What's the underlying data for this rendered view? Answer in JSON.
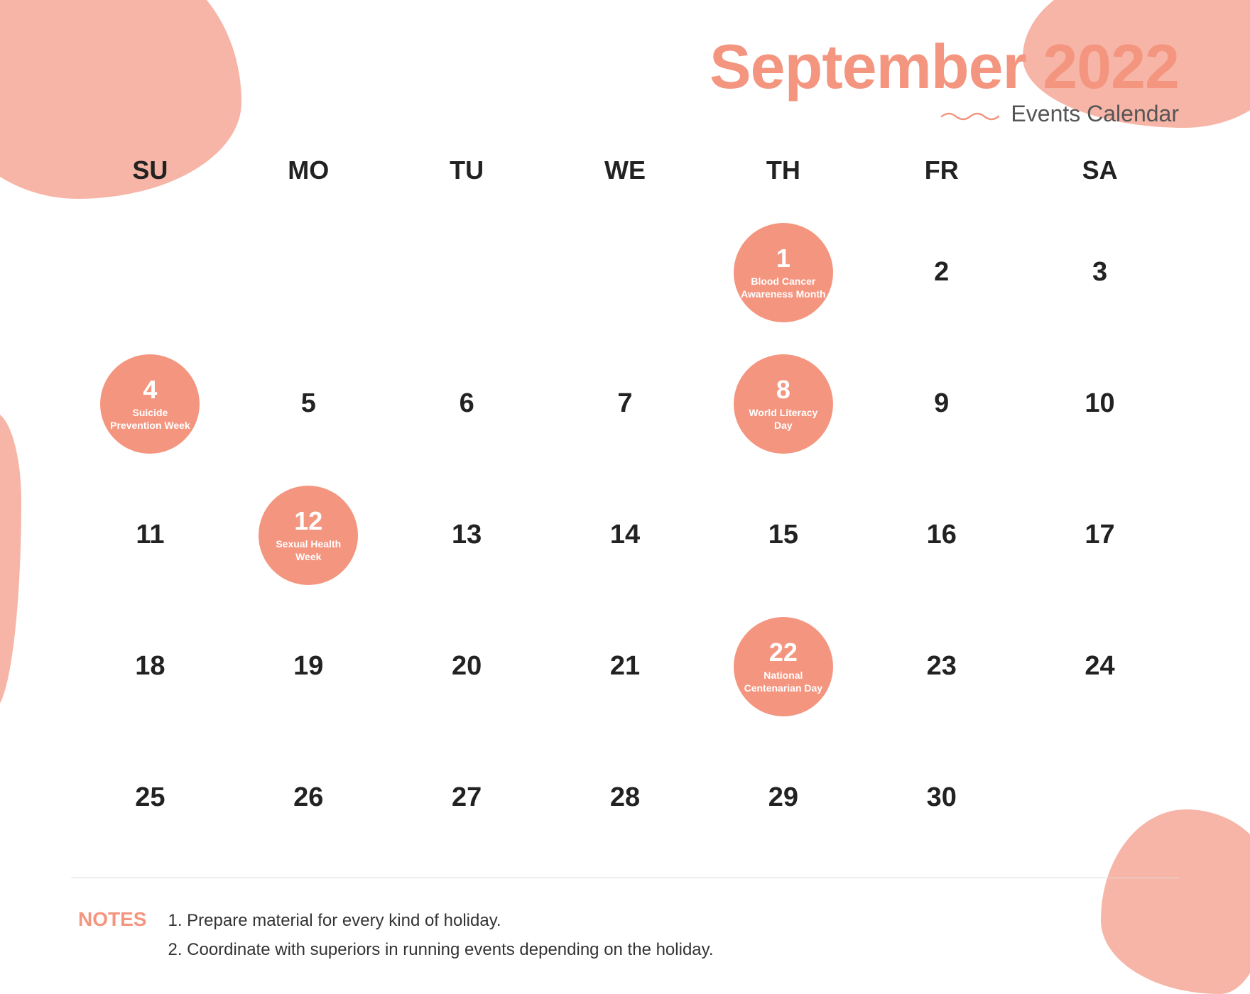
{
  "header": {
    "month": "September",
    "year": "2022",
    "subtitle": "Events Calendar"
  },
  "days": {
    "headers": [
      "SU",
      "MO",
      "TU",
      "WE",
      "TH",
      "FR",
      "SA"
    ]
  },
  "calendar": {
    "rows": [
      [
        {
          "day": "",
          "event": null
        },
        {
          "day": "",
          "event": null
        },
        {
          "day": "",
          "event": null
        },
        {
          "day": "",
          "event": null
        },
        {
          "day": "1",
          "event": {
            "label": "Blood Cancer Awareness Month"
          }
        },
        {
          "day": "2",
          "event": null
        },
        {
          "day": "3",
          "event": null
        }
      ],
      [
        {
          "day": "4",
          "event": {
            "label": "Suicide Prevention Week"
          }
        },
        {
          "day": "5",
          "event": null
        },
        {
          "day": "6",
          "event": null
        },
        {
          "day": "7",
          "event": null
        },
        {
          "day": "8",
          "event": {
            "label": "World Literacy Day"
          }
        },
        {
          "day": "9",
          "event": null
        },
        {
          "day": "10",
          "event": null
        }
      ],
      [
        {
          "day": "11",
          "event": null
        },
        {
          "day": "12",
          "event": {
            "label": "Sexual Health Week"
          }
        },
        {
          "day": "13",
          "event": null
        },
        {
          "day": "14",
          "event": null
        },
        {
          "day": "15",
          "event": null
        },
        {
          "day": "16",
          "event": null
        },
        {
          "day": "17",
          "event": null
        }
      ],
      [
        {
          "day": "18",
          "event": null
        },
        {
          "day": "19",
          "event": null
        },
        {
          "day": "20",
          "event": null
        },
        {
          "day": "21",
          "event": null
        },
        {
          "day": "22",
          "event": {
            "label": "National Centenarian Day"
          }
        },
        {
          "day": "23",
          "event": null
        },
        {
          "day": "24",
          "event": null
        }
      ],
      [
        {
          "day": "25",
          "event": null
        },
        {
          "day": "26",
          "event": null
        },
        {
          "day": "27",
          "event": null
        },
        {
          "day": "28",
          "event": null
        },
        {
          "day": "29",
          "event": null
        },
        {
          "day": "30",
          "event": null
        },
        {
          "day": "",
          "event": null
        }
      ]
    ]
  },
  "notes": {
    "label": "NOTES",
    "items": [
      "1. Prepare material for every kind of holiday.",
      "2. Coordinate with superiors in running events depending on the holiday."
    ]
  }
}
